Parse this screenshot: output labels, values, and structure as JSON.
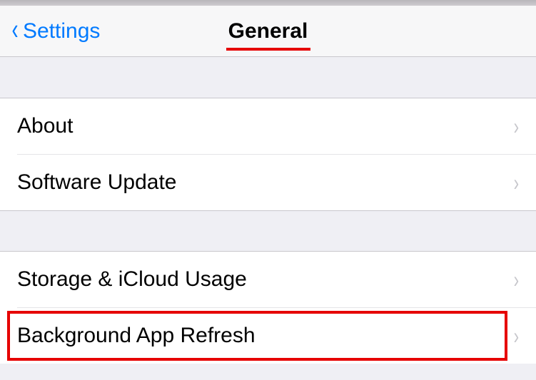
{
  "nav": {
    "back_label": "Settings",
    "title": "General"
  },
  "groups": [
    {
      "rows": [
        {
          "label": "About",
          "name": "row-about"
        },
        {
          "label": "Software Update",
          "name": "row-software-update"
        }
      ]
    },
    {
      "rows": [
        {
          "label": "Storage & iCloud Usage",
          "name": "row-storage-icloud-usage"
        },
        {
          "label": "Background App Refresh",
          "name": "row-background-app-refresh",
          "highlighted": true
        }
      ]
    }
  ],
  "annotations": {
    "title_underline_color": "#e60000",
    "highlight_color": "#e60000"
  }
}
